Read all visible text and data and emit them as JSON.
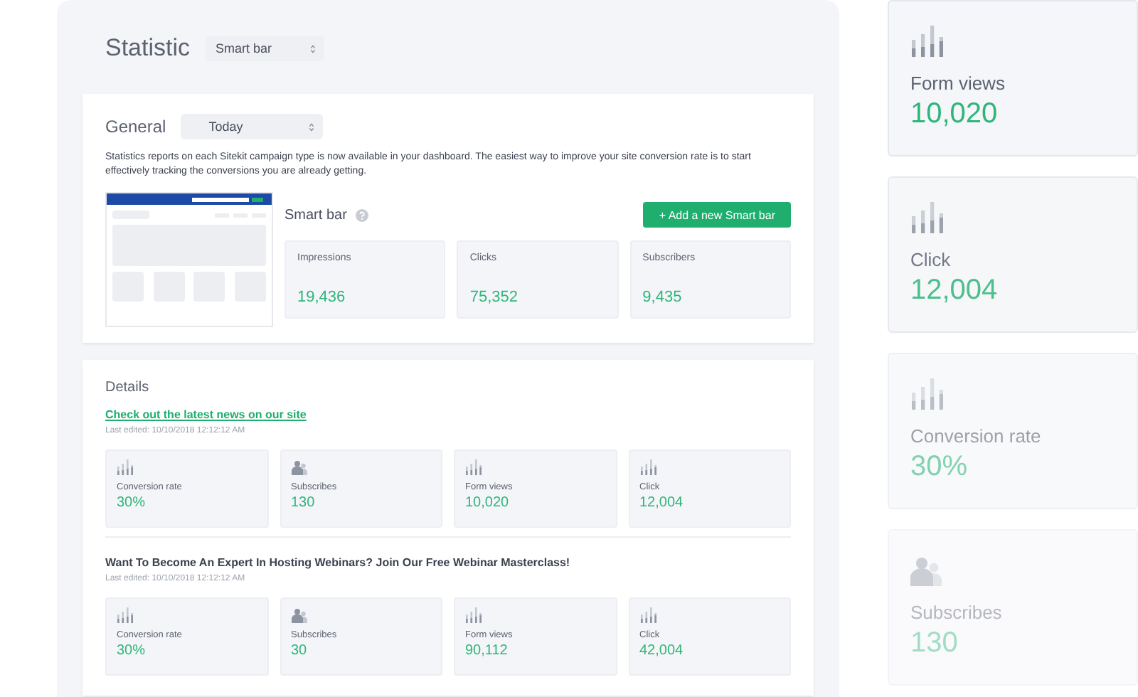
{
  "header": {
    "title": "Statistic",
    "select": "Smart bar"
  },
  "general": {
    "title": "General",
    "select": "Today",
    "description": "Statistics reports on each Sitekit campaign type is now available in your dashboard. The easiest way to improve your site conversion rate is to start effectively tracking the conversions you are already getting.",
    "widget_title": "Smart bar",
    "add_button": "+ Add a new Smart bar",
    "metrics": [
      {
        "label": "Impressions",
        "value": "19,436"
      },
      {
        "label": "Clicks",
        "value": "75,352"
      },
      {
        "label": "Subscribers",
        "value": "9,435"
      }
    ]
  },
  "details": {
    "title": "Details",
    "items": [
      {
        "title": "Check out the latest news on our site",
        "kind": "link",
        "edited": "Last edited: 10/10/2018 12:12:12 AM",
        "stats": [
          {
            "kind": "bars",
            "label": "Conversion rate",
            "value": "30%"
          },
          {
            "kind": "people",
            "label": "Subscribes",
            "value": "130"
          },
          {
            "kind": "bars",
            "label": "Form views",
            "value": "10,020"
          },
          {
            "kind": "bars",
            "label": "Click",
            "value": "12,004"
          }
        ]
      },
      {
        "title": "Want To Become An Expert In Hosting Webinars? Join Our Free Webinar Masterclass!",
        "kind": "heading",
        "edited": "Last edited: 10/10/2018 12:12:12 AM",
        "stats": [
          {
            "kind": "bars",
            "label": "Conversion rate",
            "value": "30%"
          },
          {
            "kind": "people",
            "label": "Subscribes",
            "value": "30"
          },
          {
            "kind": "bars",
            "label": "Form views",
            "value": "90,112"
          },
          {
            "kind": "bars",
            "label": "Click",
            "value": "42,004"
          }
        ]
      }
    ]
  },
  "side_cards": [
    {
      "kind": "bars",
      "label": "Form views",
      "value": "10,020"
    },
    {
      "kind": "bars",
      "label": "Click",
      "value": "12,004"
    },
    {
      "kind": "bars",
      "label": "Conversion rate",
      "value": "30%"
    },
    {
      "kind": "people",
      "label": "Subscribes",
      "value": "130"
    }
  ]
}
